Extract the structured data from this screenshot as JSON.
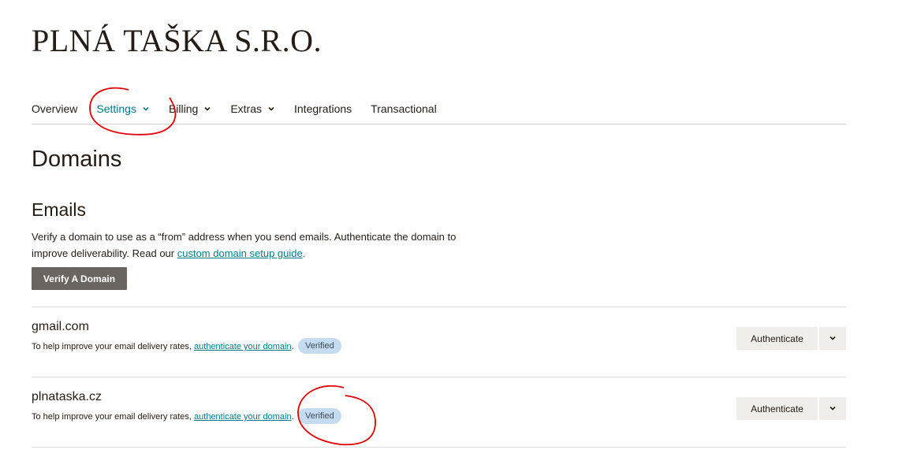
{
  "brand": {
    "name": "PLNÁ TAŠKA S.R.O."
  },
  "nav": {
    "items": [
      {
        "label": "Overview",
        "dropdown": false
      },
      {
        "label": "Settings",
        "dropdown": true,
        "active": true
      },
      {
        "label": "Billing",
        "dropdown": true
      },
      {
        "label": "Extras",
        "dropdown": true
      },
      {
        "label": "Integrations",
        "dropdown": false
      },
      {
        "label": "Transactional",
        "dropdown": false
      }
    ]
  },
  "page": {
    "title": "Domains"
  },
  "emails": {
    "heading": "Emails",
    "description_part1": "Verify a domain to use as a “from” address when you send emails. Authenticate the domain to improve deliverability. Read our ",
    "description_link": "custom domain setup guide",
    "description_part2": ".",
    "verify_button": "Verify A Domain"
  },
  "domains": [
    {
      "name": "gmail.com",
      "help_prefix": "To help improve your email delivery rates, ",
      "help_link": "authenticate your domain",
      "help_suffix": ".",
      "status": "Verified",
      "action": "Authenticate"
    },
    {
      "name": "plnataska.cz",
      "help_prefix": "To help improve your email delivery rates, ",
      "help_link": "authenticate your domain",
      "help_suffix": ".",
      "status": "Verified",
      "action": "Authenticate"
    }
  ],
  "colors": {
    "accent": "#007c89",
    "verify_button": "#6b6562",
    "badge": "#c5dcf0",
    "annotation": "#e00000"
  },
  "icons": {
    "dropdown": "chevron-down-icon"
  }
}
